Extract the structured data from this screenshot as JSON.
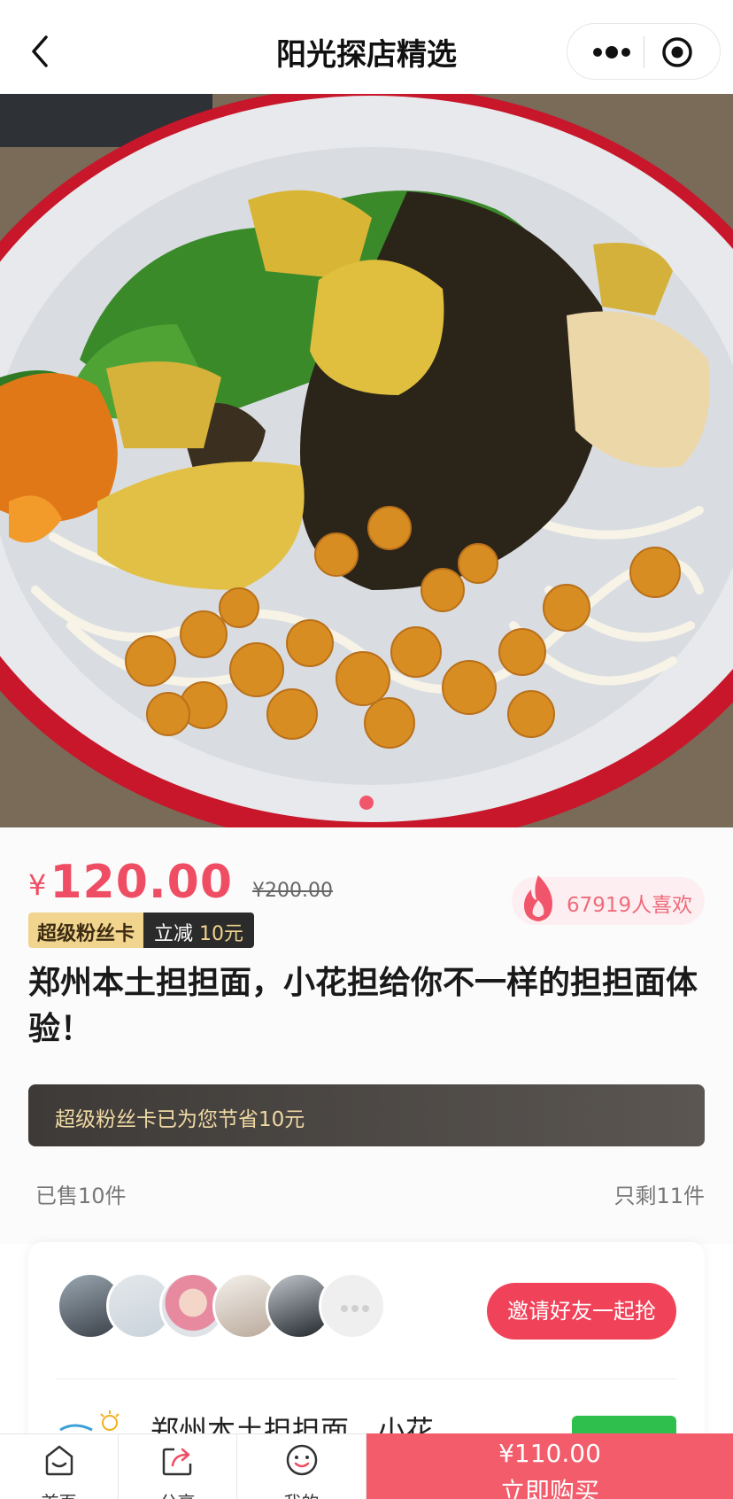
{
  "nav": {
    "title": "阳光探店精选"
  },
  "product": {
    "currency": "¥",
    "price": "120.00",
    "original_price": "¥200.00",
    "likes": "67919人喜欢",
    "badge_left": "超级粉丝卡",
    "badge_right_prefix": "立减 ",
    "badge_right_amount": "10元",
    "title": "郑州本土担担面，小花担给你不一样的担担面体验！",
    "save_text": "超级粉丝卡已为您节省10元",
    "sold": "已售10件",
    "remaining": "只剩11件"
  },
  "group": {
    "invite_label": "邀请好友一起抢",
    "shop_name": "郑州本土担担面，小花"
  },
  "tabbar": {
    "home": "首页",
    "share": "分享",
    "mine": "我的"
  },
  "buy": {
    "price": "¥110.00",
    "label": "立即购买"
  },
  "colors": {
    "accent": "#ef4d63",
    "buy_bg": "#f25c6b",
    "gold": "#f1d48e"
  }
}
